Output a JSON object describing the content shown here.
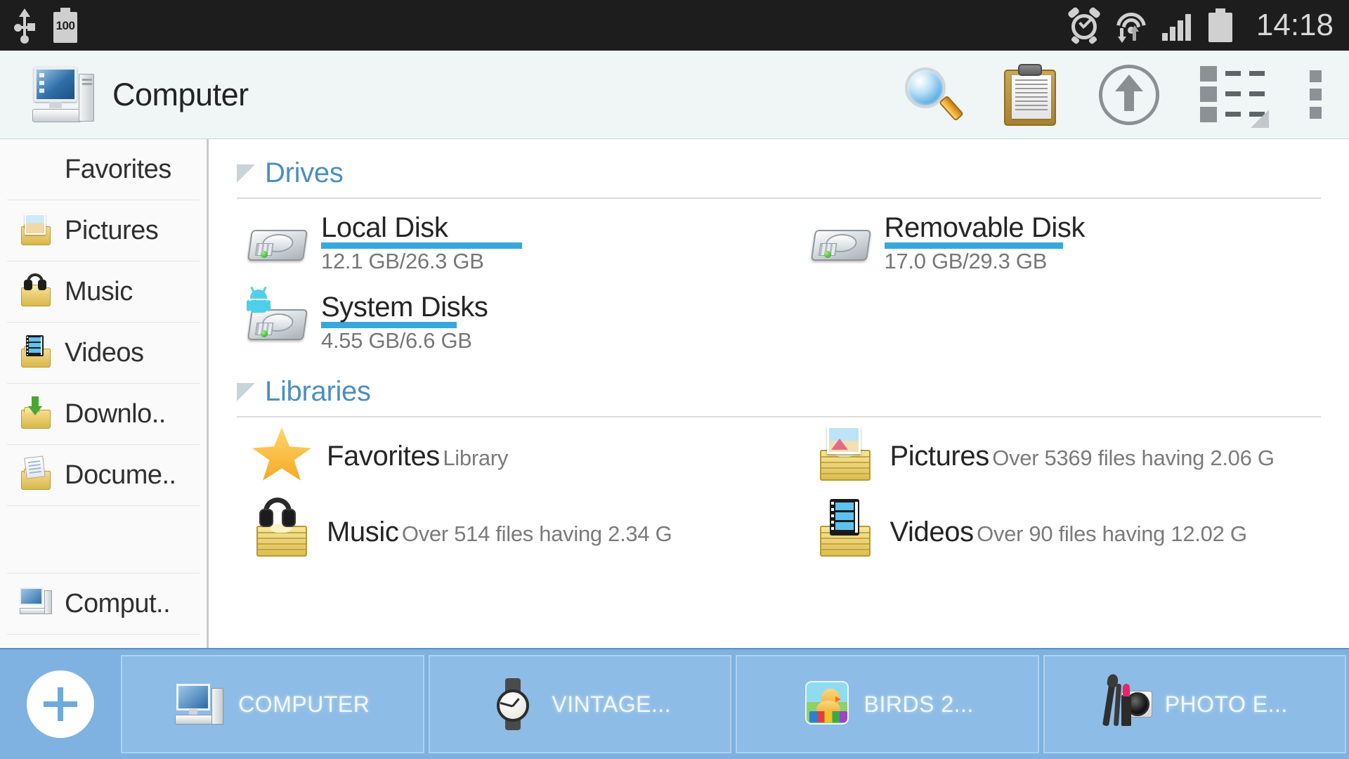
{
  "statusbar": {
    "time": "14:18",
    "battery_level": "100",
    "icons": [
      "usb-icon",
      "battery-icon",
      "alarm-icon",
      "wifi-icon",
      "signal-icon",
      "battery-full-icon"
    ]
  },
  "toolbar": {
    "title": "Computer",
    "title_icon": "computer-icon",
    "actions": [
      {
        "name": "search-icon",
        "label": "Search"
      },
      {
        "name": "clipboard-icon",
        "label": "Clipboard"
      },
      {
        "name": "up-arrow-icon",
        "label": "Up"
      },
      {
        "name": "list-view-icon",
        "label": "View"
      },
      {
        "name": "overflow-menu-icon",
        "label": "More"
      }
    ]
  },
  "sidebar": {
    "items": [
      {
        "label": "Favorites",
        "icon": "star-icon"
      },
      {
        "label": "Pictures",
        "icon": "pictures-folder-icon"
      },
      {
        "label": "Music",
        "icon": "music-folder-icon"
      },
      {
        "label": "Videos",
        "icon": "videos-folder-icon"
      },
      {
        "label": "Downlo..",
        "icon": "downloads-folder-icon"
      },
      {
        "label": "Docume..",
        "icon": "documents-folder-icon"
      },
      {
        "label": "Comput..",
        "icon": "computer-icon"
      }
    ]
  },
  "main": {
    "sections": [
      {
        "title": "Drives"
      },
      {
        "title": "Libraries"
      }
    ],
    "drives": [
      {
        "name": "Local Disk",
        "size": "12.1 GB/26.3 GB",
        "used_gb": 12.1,
        "total_gb": 26.3,
        "percent": 46,
        "icon": "hard-disk-icon"
      },
      {
        "name": "Removable Disk",
        "size": "17.0 GB/29.3 GB",
        "used_gb": 17.0,
        "total_gb": 29.3,
        "percent": 41,
        "icon": "hard-disk-icon"
      },
      {
        "name": "System Disks",
        "size": "4.55 GB/6.6 GB",
        "used_gb": 4.55,
        "total_gb": 6.6,
        "percent": 31,
        "icon": "android-disk-icon"
      }
    ],
    "libraries": [
      {
        "name": "Favorites",
        "sub": "Library",
        "icon": "star-library-icon"
      },
      {
        "name": "Pictures",
        "sub": "Over 5369 files having 2.06 G",
        "icon": "pictures-library-icon"
      },
      {
        "name": "Music",
        "sub": "Over 514 files having 2.34 G",
        "icon": "music-library-icon"
      },
      {
        "name": "Videos",
        "sub": "Over 90 files having 12.02 G",
        "icon": "videos-library-icon"
      }
    ]
  },
  "taskbar": {
    "add_button": "add-tab-button",
    "tabs": [
      {
        "label": "COMPUTER",
        "icon": "computer-icon"
      },
      {
        "label": "VINTAGE...",
        "icon": "watch-icon"
      },
      {
        "label": "BIRDS 2...",
        "icon": "birds-app-icon"
      },
      {
        "label": "PHOTO E...",
        "icon": "photo-editor-icon"
      }
    ]
  },
  "colors": {
    "accent_blue": "#35a8dd",
    "section_title": "#4b8fc0",
    "toolbar_bg": "#f0f5f6",
    "taskbar_bg": "#7fb2e0",
    "statusbar_bg": "#1d1d1d"
  }
}
